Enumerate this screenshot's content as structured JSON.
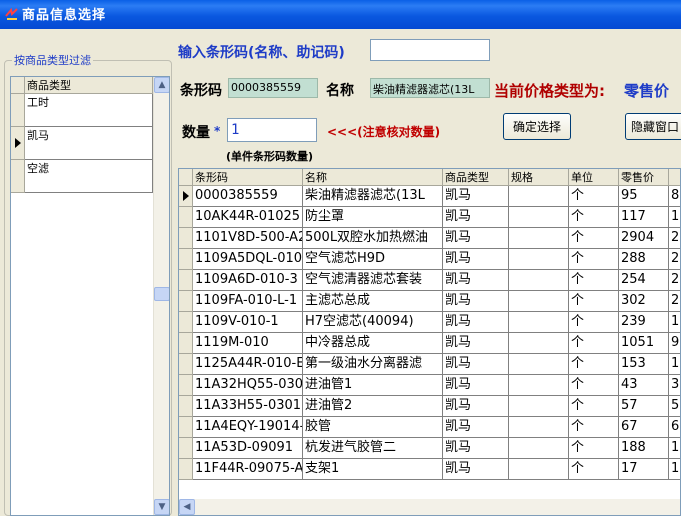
{
  "window": {
    "title": "商品信息选择"
  },
  "filter": {
    "legend": "按商品类型过滤",
    "column_header": "商品类型",
    "rows": [
      "工时",
      "凯马",
      "空滤"
    ],
    "selected_row": 1
  },
  "search": {
    "label": "输入条形码(名称、助记码)",
    "value": ""
  },
  "barcode": {
    "label": "条形码",
    "value": "0000385559"
  },
  "name": {
    "label": "名称",
    "value": "柴油精滤器滤芯(13L"
  },
  "price_type": {
    "label": "当前价格类型为:",
    "value": "零售价"
  },
  "quantity": {
    "label": "数量",
    "asterisk": "*",
    "value": "1",
    "note": "<<<(注意核对数量)",
    "unit_note": "(单件条形码数量)"
  },
  "buttons": {
    "confirm": "确定选择",
    "hide": "隐藏窗口"
  },
  "table": {
    "columns": [
      "条形码",
      "名称",
      "商品类型",
      "规格",
      "单位",
      "零售价",
      ""
    ],
    "rows": [
      [
        "0000385559",
        "柴油精滤器滤芯(13L",
        "凯马",
        "",
        "个",
        "95",
        "8"
      ],
      [
        "10AK44R-01025",
        "防尘罩",
        "凯马",
        "",
        "个",
        "117",
        "1"
      ],
      [
        "1101V8D-500-A2",
        "500L双腔水加热燃油",
        "凯马",
        "",
        "个",
        "2904",
        "2"
      ],
      [
        "1109A5DQL-010-",
        "空气滤芯H9D",
        "凯马",
        "",
        "个",
        "288",
        "2"
      ],
      [
        "1109A6D-010-3",
        "空气滤清器滤芯套装",
        "凯马",
        "",
        "个",
        "254",
        "2"
      ],
      [
        "1109FA-010-L-1",
        "主滤芯总成",
        "凯马",
        "",
        "个",
        "302",
        "2"
      ],
      [
        "1109V-010-1",
        "H7空滤芯(40094)",
        "凯马",
        "",
        "个",
        "239",
        "1"
      ],
      [
        "1119M-010",
        "中冷器总成",
        "凯马",
        "",
        "个",
        "1051",
        "9"
      ],
      [
        "1125A44R-010-E",
        "第一级油水分离器滤",
        "凯马",
        "",
        "个",
        "153",
        "1"
      ],
      [
        "11A32HQ55-0301",
        "进油管1",
        "凯马",
        "",
        "个",
        "43",
        "3"
      ],
      [
        "11A33H55-0301",
        "进油管2",
        "凯马",
        "",
        "个",
        "57",
        "5"
      ],
      [
        "11A4EQY-19014-",
        "胶管",
        "凯马",
        "",
        "个",
        "67",
        "6"
      ],
      [
        "11A53D-09091",
        "杭发进气胶管二",
        "凯马",
        "",
        "个",
        "188",
        "1"
      ],
      [
        "11F44R-09075-A",
        "支架1",
        "凯马",
        "",
        "个",
        "17",
        "1"
      ]
    ]
  },
  "colors": {
    "title_blue": "#0a58e0",
    "label_blue": "#1e3cc7",
    "price_red": "#b00000",
    "note_red": "#c00000",
    "green_box": "#c2dfd2"
  }
}
